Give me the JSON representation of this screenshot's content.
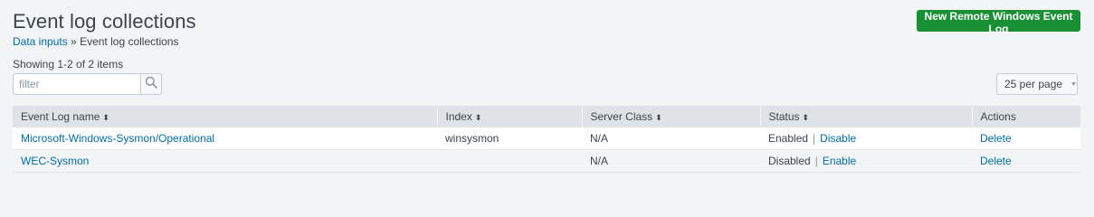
{
  "header": {
    "title": "Event log collections",
    "breadcrumb_link": "Data inputs",
    "breadcrumb_separator": "»",
    "breadcrumb_current": "Event log collections",
    "new_button_label": "New Remote Windows Event Log",
    "new_button_color": "#1a9035"
  },
  "toolbar": {
    "count_text": "Showing 1-2 of 2 items",
    "filter_placeholder": "filter",
    "filter_value": "",
    "search_icon": "search-icon",
    "per_page_label": "25 per page"
  },
  "table": {
    "columns": [
      "Event Log name",
      "Index",
      "Server Class",
      "Status",
      "Actions"
    ],
    "sort_glyph": "⬍",
    "status_separator": "|",
    "rows": [
      {
        "name": "Microsoft-Windows-Sysmon/Operational",
        "index": "winsysmon",
        "server_class": "N/A",
        "status": "Enabled",
        "toggle_action": "Disable",
        "action": "Delete"
      },
      {
        "name": "WEC-Sysmon",
        "index": "",
        "server_class": "N/A",
        "status": "Disabled",
        "toggle_action": "Enable",
        "action": "Delete"
      }
    ]
  },
  "colors": {
    "link": "#006eaa",
    "header_bg": "#dfe3e8",
    "page_bg": "#f2f4f5"
  }
}
